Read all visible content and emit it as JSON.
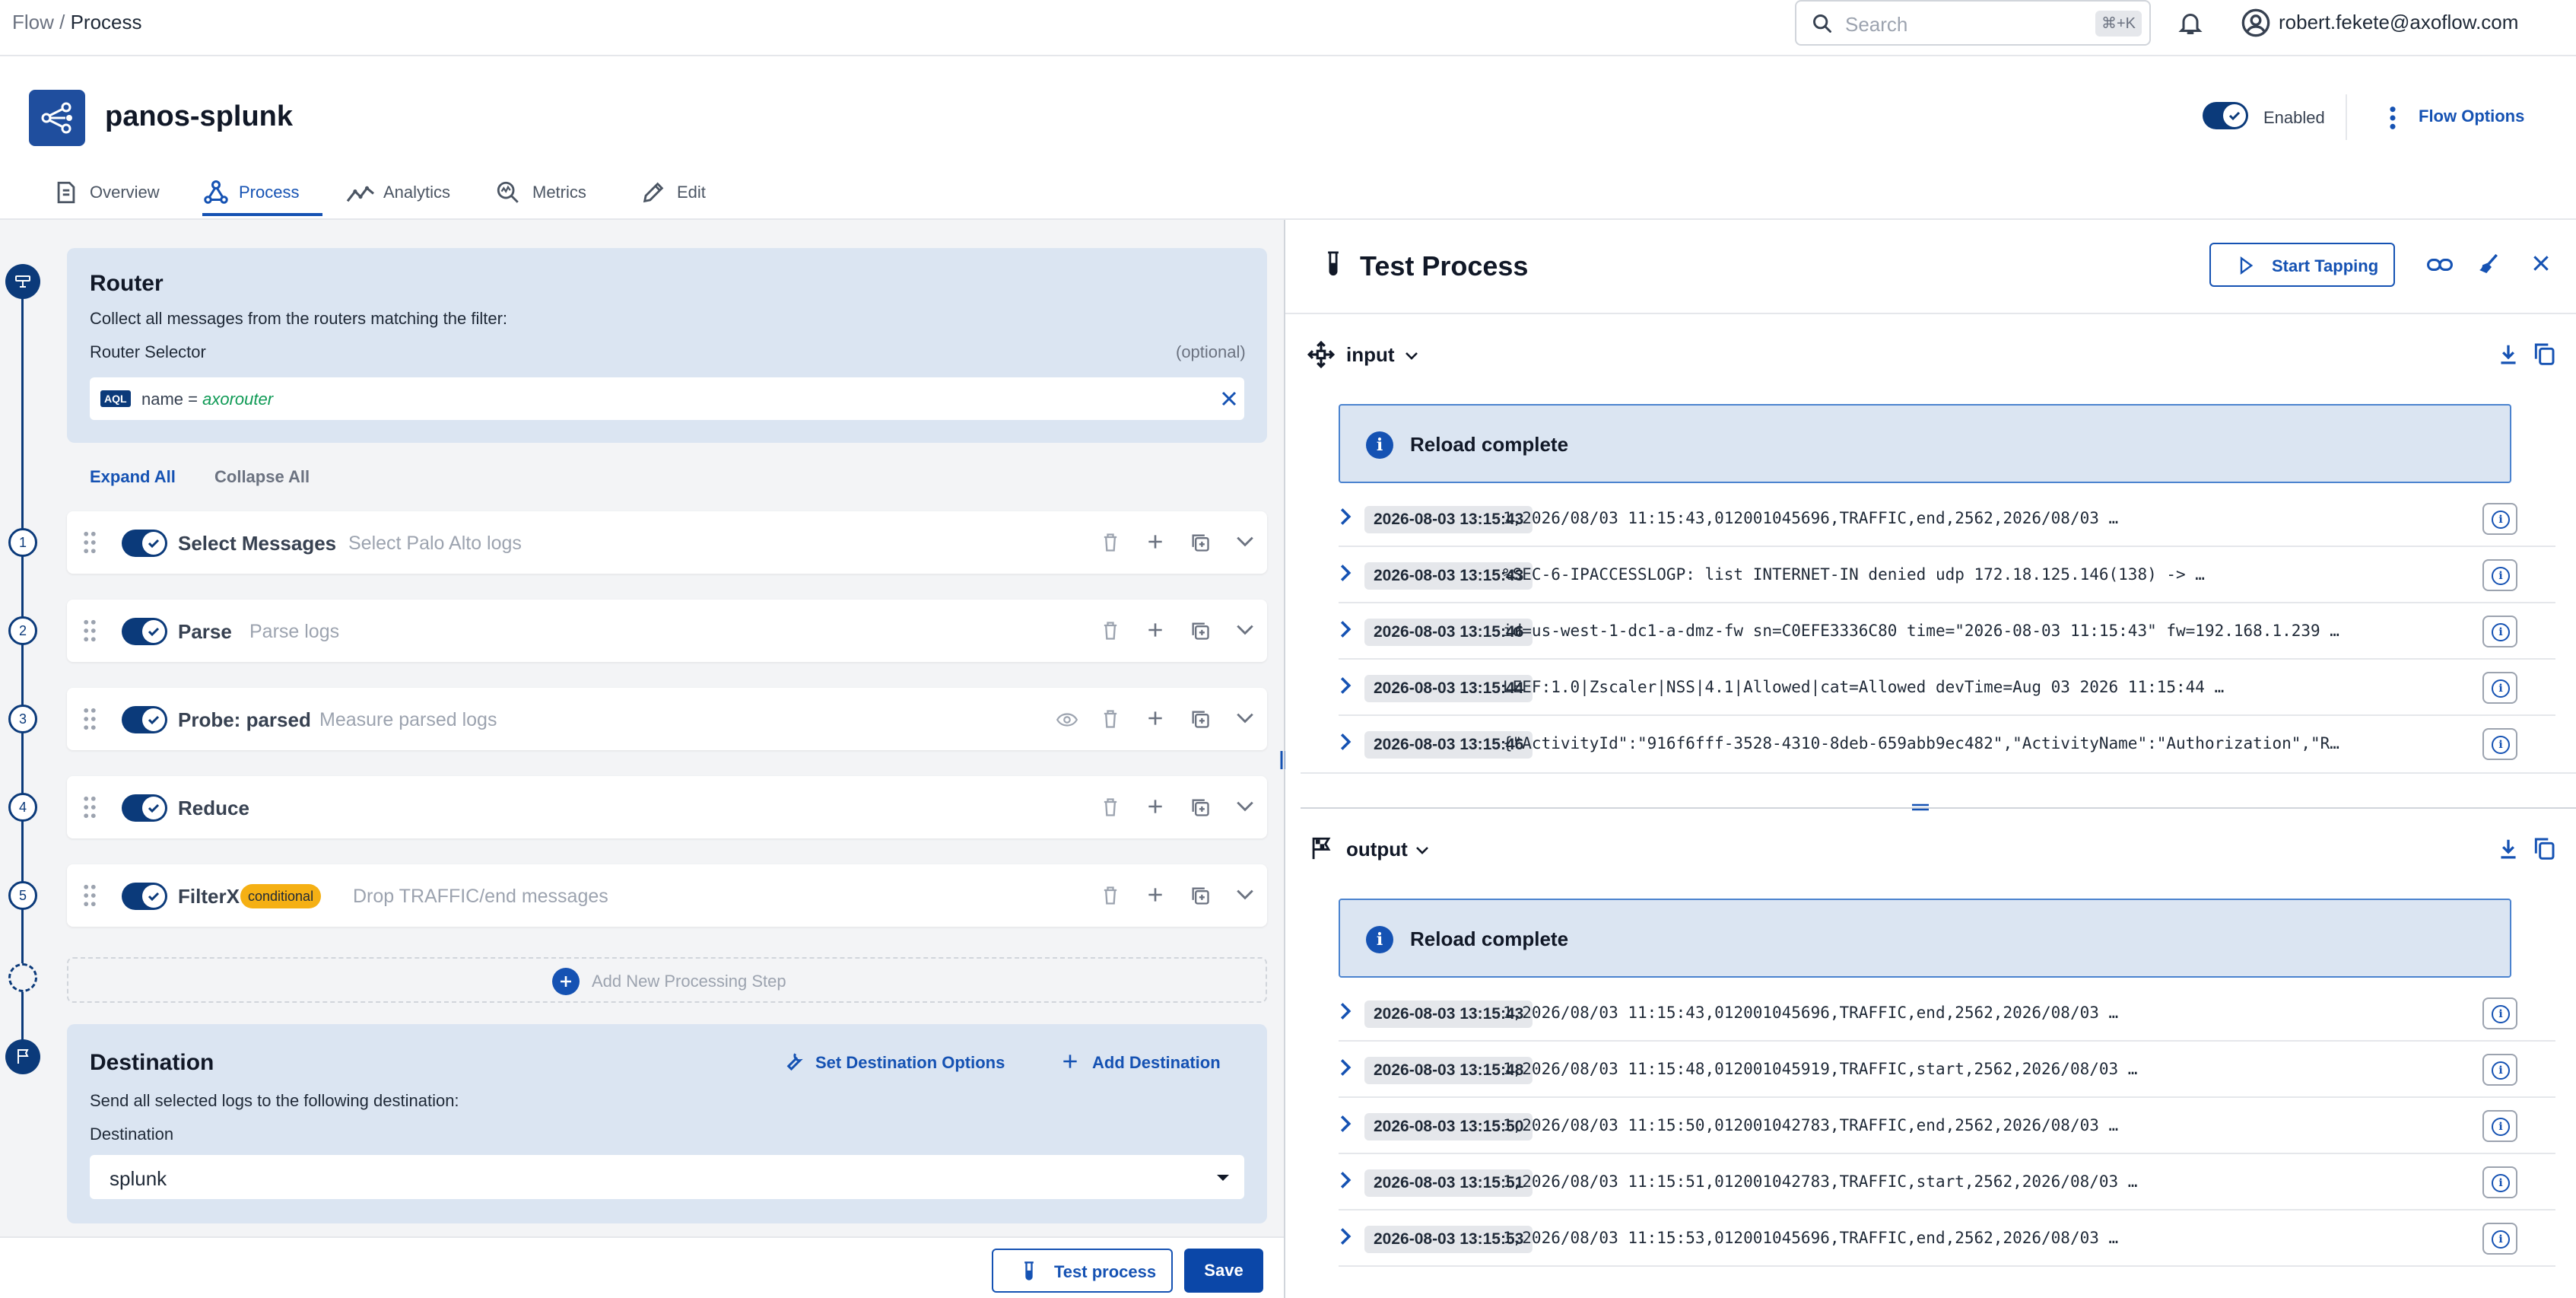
{
  "topbar": {
    "breadcrumb_root": "Flow",
    "breadcrumb_sep": " / ",
    "breadcrumb_current": "Process",
    "search_placeholder": "Search",
    "search_shortcut": "⌘+K",
    "user_email": "robert.fekete@axoflow.com"
  },
  "flow": {
    "name": "panos-splunk",
    "enabled_label": "Enabled",
    "options_label": "Flow Options"
  },
  "tabs": [
    {
      "label": "Overview",
      "icon": "overview-icon"
    },
    {
      "label": "Process",
      "icon": "process-icon",
      "active": true
    },
    {
      "label": "Analytics",
      "icon": "analytics-icon"
    },
    {
      "label": "Metrics",
      "icon": "metrics-icon"
    },
    {
      "label": "Edit",
      "icon": "edit-icon"
    }
  ],
  "router": {
    "title": "Router",
    "description": "Collect all messages from the routers matching the filter:",
    "selector_label": "Router Selector",
    "optional_label": "(optional)",
    "aql_badge": "AQL",
    "aql_field": "name",
    "aql_op": " = ",
    "aql_value": "axorouter"
  },
  "controls": {
    "expand_all": "Expand All",
    "collapse_all": "Collapse All"
  },
  "steps": [
    {
      "number": "1",
      "name": "Select Messages",
      "description": "Select Palo Alto logs",
      "enabled": true
    },
    {
      "number": "2",
      "name": "Parse",
      "description": "Parse logs",
      "enabled": true
    },
    {
      "number": "3",
      "name": "Probe: parsed",
      "description": "Measure parsed logs",
      "enabled": true
    },
    {
      "number": "4",
      "name": "Reduce",
      "description": "",
      "enabled": true
    },
    {
      "number": "5",
      "name": "FilterX",
      "badge": "conditional",
      "description": "Drop TRAFFIC/end messages",
      "enabled": true
    }
  ],
  "add_step_label": "Add New Processing Step",
  "destination": {
    "title": "Destination",
    "set_options_label": "Set Destination Options",
    "add_label": "Add Destination",
    "description": "Send all selected logs to the following destination:",
    "field_label": "Destination",
    "value": "splunk"
  },
  "bottom": {
    "test_label": "Test process",
    "save_label": "Save"
  },
  "test_panel": {
    "title": "Test Process",
    "start_tapping": "Start Tapping",
    "input": {
      "label": "input",
      "reload": "Reload complete",
      "rows": [
        {
          "ts": "2026-08-03 13:15:43",
          "msg": "1,2026/08/03 11:15:43,012001045696,TRAFFIC,end,2562,2026/08/03 …"
        },
        {
          "ts": "2026-08-03 13:15:43",
          "msg": "%SEC-6-IPACCESSLOGP: list INTERNET-IN denied udp 172.18.125.146(138) -> …"
        },
        {
          "ts": "2026-08-03 13:15:46",
          "msg": "id=us-west-1-dc1-a-dmz-fw sn=C0EFE3336C80 time=\"2026-08-03 11:15:43\" fw=192.168.1.239 …"
        },
        {
          "ts": "2026-08-03 13:15:44",
          "msg": "LEEF:1.0|Zscaler|NSS|4.1|Allowed|cat=Allowed    devTime=Aug 03 2026 11:15:44 …"
        },
        {
          "ts": "2026-08-03 13:15:46",
          "msg": "{\"ActivityId\":\"916f6fff-3528-4310-8deb-659abb9ec482\",\"ActivityName\":\"Authorization\",\"R…"
        }
      ]
    },
    "output": {
      "label": "output",
      "reload": "Reload complete",
      "rows": [
        {
          "ts": "2026-08-03 13:15:43",
          "msg": "1,2026/08/03 11:15:43,012001045696,TRAFFIC,end,2562,2026/08/03 …"
        },
        {
          "ts": "2026-08-03 13:15:48",
          "msg": "1,2026/08/03 11:15:48,012001045919,TRAFFIC,start,2562,2026/08/03 …"
        },
        {
          "ts": "2026-08-03 13:15:50",
          "msg": "1,2026/08/03 11:15:50,012001042783,TRAFFIC,end,2562,2026/08/03 …"
        },
        {
          "ts": "2026-08-03 13:15:51",
          "msg": "1,2026/08/03 11:15:51,012001042783,TRAFFIC,start,2562,2026/08/03 …"
        },
        {
          "ts": "2026-08-03 13:15:53",
          "msg": "1,2026/08/03 11:15:53,012001045696,TRAFFIC,end,2562,2026/08/03 …"
        }
      ]
    }
  },
  "colors": {
    "primary": "#1552b3",
    "navy": "#0b3a7a",
    "panel_blue": "#dbe5f2",
    "badge_yellow": "#f5b014"
  }
}
